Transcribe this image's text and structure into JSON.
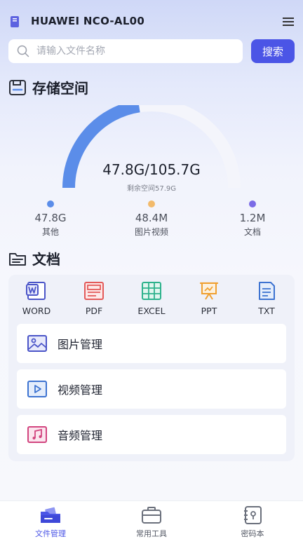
{
  "header": {
    "device_name": "HUAWEI NCO-AL00"
  },
  "search": {
    "placeholder": "请输入文件名称",
    "button_label": "搜索"
  },
  "storage": {
    "title": "存储空间",
    "used_total": "47.8G/105.7G",
    "free_text": "剩余空间57.9G",
    "used_fraction": 0.452,
    "colors": {
      "used": "#5b8de9",
      "track": "#f4f5fb"
    },
    "breakdown": [
      {
        "value": "47.8G",
        "label": "其他",
        "color": "#5b8de9"
      },
      {
        "value": "48.4M",
        "label": "图片视频",
        "color": "#f2ba6b"
      },
      {
        "value": "1.2M",
        "label": "文档",
        "color": "#7b6be6"
      }
    ]
  },
  "documents": {
    "title": "文档",
    "file_types": [
      {
        "label": "WORD",
        "icon": "word-icon",
        "color": "#4b55c8"
      },
      {
        "label": "PDF",
        "icon": "pdf-icon",
        "color": "#e35a5a"
      },
      {
        "label": "EXCEL",
        "icon": "excel-icon",
        "color": "#2db28c"
      },
      {
        "label": "PPT",
        "icon": "ppt-icon",
        "color": "#f0a030"
      },
      {
        "label": "TXT",
        "icon": "txt-icon",
        "color": "#3d73d1"
      }
    ],
    "managers": [
      {
        "label": "图片管理",
        "icon": "image-icon",
        "color": "#4b55c8"
      },
      {
        "label": "视频管理",
        "icon": "video-icon",
        "color": "#3d73d1"
      },
      {
        "label": "音频管理",
        "icon": "music-icon",
        "color": "#d2457f"
      }
    ]
  },
  "tabbar": {
    "active_color": "#4b55e6",
    "inactive_color": "#555a66",
    "tabs": [
      {
        "label": "文件管理",
        "active": true
      },
      {
        "label": "常用工具",
        "active": false
      },
      {
        "label": "密码本",
        "active": false
      }
    ]
  }
}
